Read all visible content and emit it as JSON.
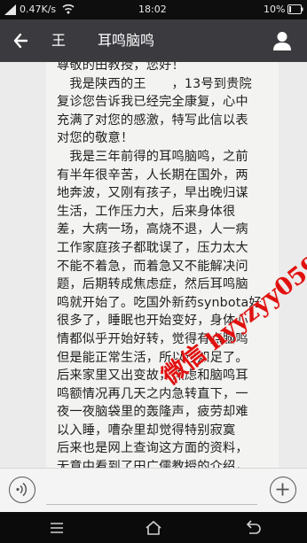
{
  "status_bar": {
    "speed": "0.47K/s",
    "time": "18:02",
    "battery": "10%"
  },
  "header": {
    "contact_name": "王",
    "title": "耳鸣脑鸣"
  },
  "message": {
    "lines": [
      "尊敬的田教授，您好！",
      "　我是陕西的王　　，13号到贵院",
      "复诊您告诉我已经完全康复，心中",
      "充满了对您的感激，特写此信以表",
      "对您的敬意！",
      "　我是三年前得的耳鸣脑鸣，之前",
      "有半年很辛苦，人长期在国外，两",
      "地奔波，又刚有孩子，早出晚归谋",
      "生活，工作压力大，后来身体很",
      "差，大病一场，高烧不退，人一病",
      "工作家庭孩子都耽误了，压力太大",
      "不能不着急，而着急又不能解决问",
      "题，后期转成焦虑症，然后耳鸣脑",
      "鸣就开始了。吃国外新药synbota好",
      "很多了，睡眠也开始变好，身体心",
      "情都似乎开始好转，觉得有点脑鸣",
      "但是能正常生活，所以也知足了。",
      "后来家里又出变故，焦虑和脑鸣耳",
      "鸣额情况再几天之内急转直下，一",
      "夜一夜脑袋里的轰隆声，疲劳却难",
      "以入睡，嘈杂里却觉得特别寂寞",
      "后来也是网上查询这方面的资料，",
      "无意中看到了田广儒教授的介绍，",
      "　　　　　　　　　　　　　　"
    ]
  },
  "watermark": {
    "text": "微信 hyyzyy059"
  },
  "icons": {
    "signal": "signal-icon",
    "wifi": "wifi-icon",
    "battery": "battery-icon",
    "back": "back-arrow-icon",
    "profile": "profile-icon",
    "voice": "voice-icon",
    "plus": "plus-icon"
  },
  "colors": {
    "header_bg": "#3a3a3f",
    "chat_bg": "#ebebeb",
    "bubble_bg": "#f3f3f1",
    "watermark": "#e0110f"
  }
}
